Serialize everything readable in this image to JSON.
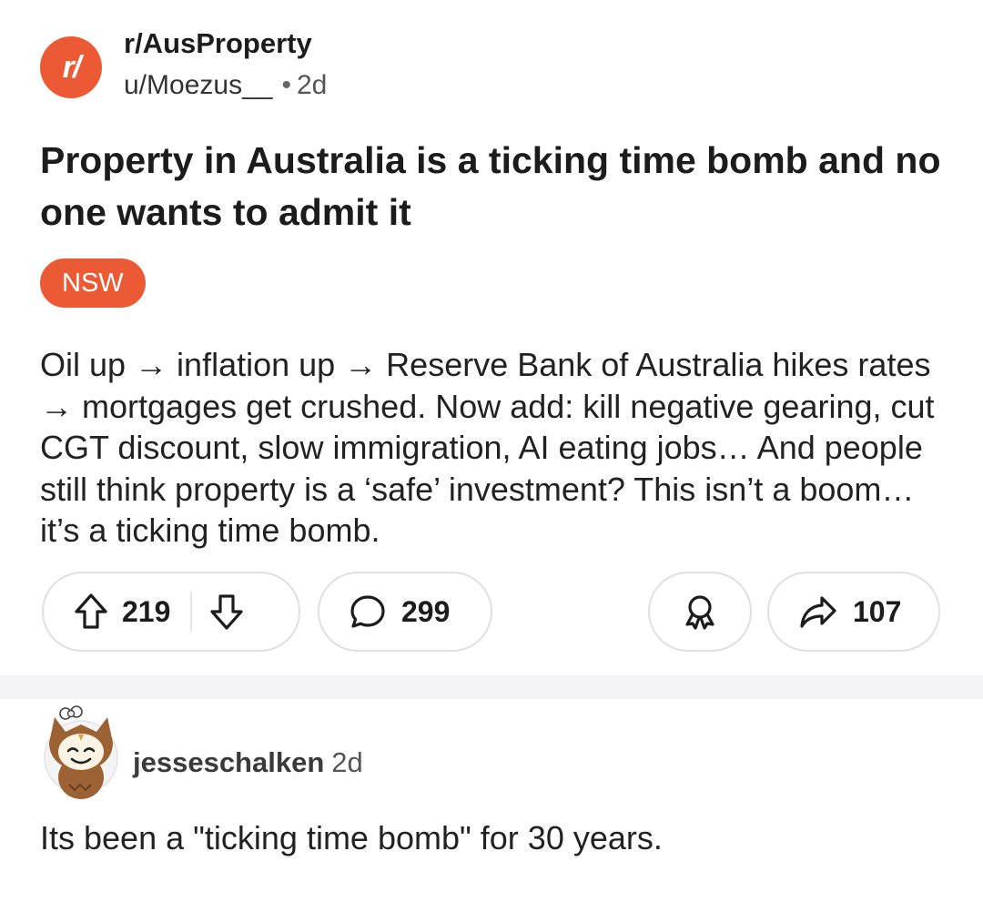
{
  "post": {
    "subreddit": "r/AusProperty",
    "subreddit_icon_text": "r/",
    "author": "u/Moezus__",
    "separator": "•",
    "age": "2d",
    "title": "Property in Australia is a ticking time bomb and no one wants to admit it",
    "flair": "NSW",
    "body": "Oil up → inflation up → Reserve Bank of Australia hikes rates → mortgages get crushed. Now add: kill negative gearing, cut CGT discount, slow immigration, AI eating jobs… And people still think property is a ‘safe’ investment? This isn’t a boom… it’s a ticking time bomb.",
    "upvotes": "219",
    "comments": "299",
    "shares": "107"
  },
  "comment": {
    "author": "jesseschalken",
    "age": "2d",
    "text": "Its been a \"ticking time bomb\" for 30 years."
  },
  "colors": {
    "accent": "#ec5a35",
    "divider": "#f3f3f5",
    "pill_border": "#e0e0e0"
  },
  "icons": [
    "upvote-icon",
    "downvote-icon",
    "comment-icon",
    "award-icon",
    "share-icon"
  ]
}
